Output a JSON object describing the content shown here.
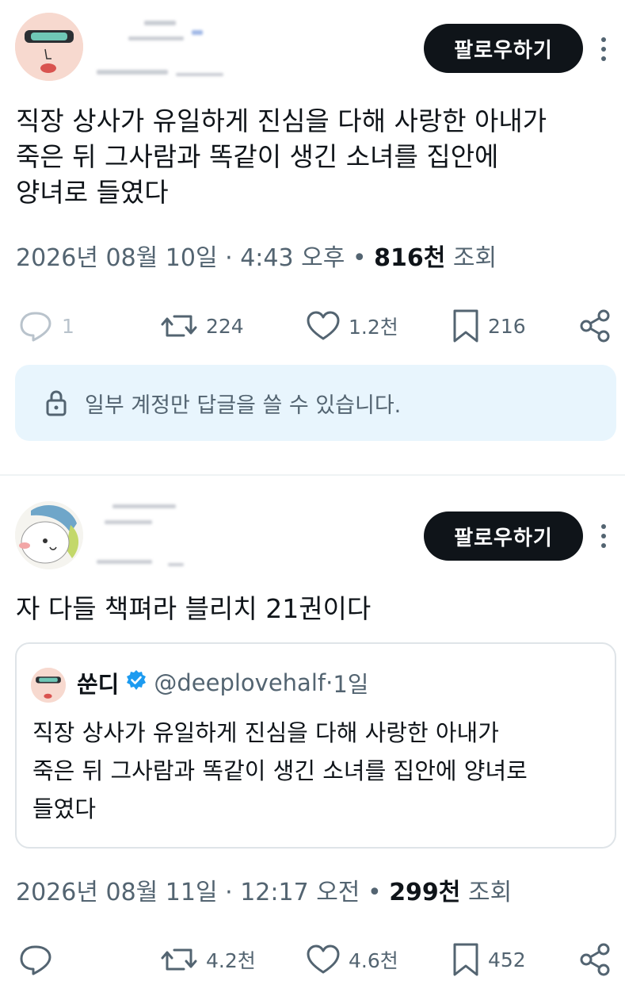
{
  "post1": {
    "follow_label": "팔로우하기",
    "text_lines": [
      "직장 상사가 유일하게 진심을 다해 사랑한 아내가",
      "죽은 뒤 그사람과 똑같이 생긴 소녀를 집안에",
      "양녀로 들였다"
    ],
    "date": "2026년 08월 10일",
    "time": "4:43 오후",
    "views_count": "816천",
    "views_label": "조회",
    "replies": "1",
    "retweets": "224",
    "likes": "1.2천",
    "bookmarks": "216",
    "notice": "일부 계정만 답글을 쓸 수 있습니다."
  },
  "post2": {
    "follow_label": "팔로우하기",
    "text": "자 다들 책펴라 블리치 21권이다",
    "quote": {
      "name": "쑨디",
      "handle": "@deeplovehalf",
      "age": "1일",
      "text_lines": [
        "직장 상사가 유일하게 진심을 다해 사랑한 아내가",
        "죽은 뒤 그사람과 똑같이 생긴 소녀를 집안에 양녀로",
        "들였다"
      ]
    },
    "date": "2026년 08월 11일",
    "time": "12:17 오전",
    "views_count": "299천",
    "views_label": "조회",
    "retweets": "4.2천",
    "likes": "4.6천",
    "bookmarks": "452"
  },
  "icons": [
    "reply-icon",
    "retweet-icon",
    "like-icon",
    "bookmark-icon",
    "share-icon",
    "lock-icon",
    "more-icon",
    "verified-badge-icon"
  ],
  "colors": {
    "text": "#0f1419",
    "muted": "#536471",
    "button_bg": "#0f1419",
    "notice_bg": "#e8f5fd",
    "verified": "#1d9bf0",
    "border": "#dfe4e8"
  }
}
